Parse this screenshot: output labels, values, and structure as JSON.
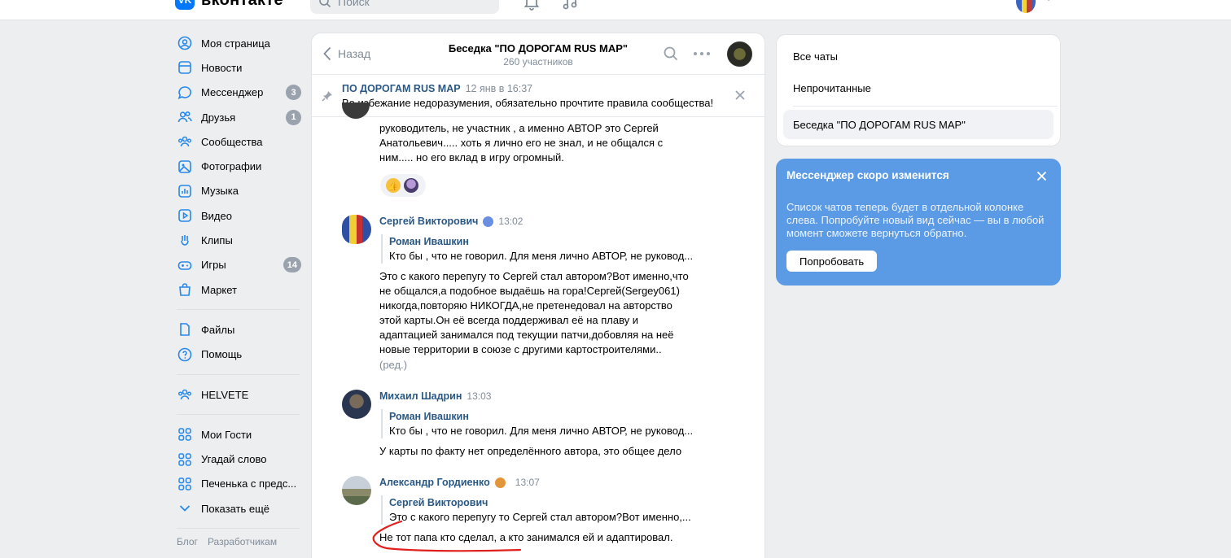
{
  "header": {
    "logo_mark": "VK",
    "logo_text": "вконтакте",
    "search_placeholder": "Поиск"
  },
  "sidebar": {
    "items": [
      {
        "label": "Моя страница",
        "icon": "user-icon"
      },
      {
        "label": "Новости",
        "icon": "news-icon"
      },
      {
        "label": "Мессенджер",
        "icon": "message-icon",
        "badge": "3"
      },
      {
        "label": "Друзья",
        "icon": "friends-icon",
        "badge": "1"
      },
      {
        "label": "Сообщества",
        "icon": "groups-icon"
      },
      {
        "label": "Фотографии",
        "icon": "photo-icon"
      },
      {
        "label": "Музыка",
        "icon": "music-icon"
      },
      {
        "label": "Видео",
        "icon": "video-icon"
      },
      {
        "label": "Клипы",
        "icon": "clips-icon"
      },
      {
        "label": "Игры",
        "icon": "games-icon",
        "badge": "14"
      },
      {
        "label": "Маркет",
        "icon": "market-icon"
      }
    ],
    "items2": [
      {
        "label": "Файлы",
        "icon": "file-icon"
      },
      {
        "label": "Помощь",
        "icon": "help-icon"
      }
    ],
    "items3": [
      {
        "label": "HELVETE",
        "icon": "groups-icon"
      }
    ],
    "items4": [
      {
        "label": "Мои Гости",
        "icon": "apps-icon"
      },
      {
        "label": "Угадай слово",
        "icon": "apps-icon"
      },
      {
        "label": "Печенька с предс...",
        "icon": "apps-icon"
      },
      {
        "label": "Показать ещё",
        "icon": "chevron-down-icon"
      }
    ],
    "footer": [
      "Блог",
      "Разработчикам"
    ]
  },
  "chat": {
    "back_label": "Назад",
    "title": "Беседка \"ПО ДОРОГАМ RUS MAP\"",
    "subtitle": "260 участников",
    "pinned": {
      "author": "ПО ДОРОГАМ RUS MAP",
      "date": "12 янв в 16:37",
      "text": "Во избежание недоразумения, обязательно прочтите правила сообщества!"
    },
    "messages": [
      {
        "text_lines": [
          "руководитель, не участник , а именно АВТОР это Сергей",
          "Анатольевич..... хоть я лично его не знал, и не общался с",
          "ним..... но его вклад в игру огромный."
        ]
      },
      {
        "author": "Сергей Викторович",
        "time": "13:02",
        "quote_author": "Роман Ивашкин",
        "quote_text": "Кто бы , что не говорил. Для меня лично АВТОР, не руковод...",
        "text_lines": [
          "Это с какого перепугу то Сергей стал автором?Вот именно,что",
          "не общался,а подобное выдаёшь на гора!Сергей(Sergey061)",
          "никогда,повторяю НИКОГДА,не претенедовал на авторство",
          "этой карты.Он её всегда поддерживал её на плаву и",
          "адаптацией занимался под текущии патчи,добовляя на неё",
          "новые территории в союзе с другими картостроителями.."
        ],
        "edited": "(ред.)"
      },
      {
        "author": "Михаил Шадрин",
        "time": "13:03",
        "quote_author": "Роман Ивашкин",
        "quote_text": "Кто бы , что не говорил. Для меня лично АВТОР, не руковод...",
        "text": "У карты по факту нет определённого автора, это общее дело"
      },
      {
        "author": "Александр Гордиенко",
        "time": "13:07",
        "quote_author": "Сергей Викторович",
        "quote_text": "Это с какого перепугу то Сергей стал автором?Вот именно,...",
        "text": "Не тот папа кто сделал, а кто занимался ей и адаптировал."
      }
    ]
  },
  "right": {
    "items": [
      "Все чаты",
      "Непрочитанные",
      "Беседка \"ПО ДОРОГАМ RUS MAP\""
    ],
    "promo": {
      "title": "Мессенджер скоро изменится",
      "text": "Список чатов теперь будет в отдельной колонке слева. Попробуйте новый вид сейчас — вы в любой момент сможете вернуться обратно.",
      "button": "Попробовать"
    }
  },
  "colors": {
    "accent": "#2688eb",
    "link": "#2a5885",
    "promo_bg": "#5b9be6",
    "annotation": "#e0201c"
  }
}
